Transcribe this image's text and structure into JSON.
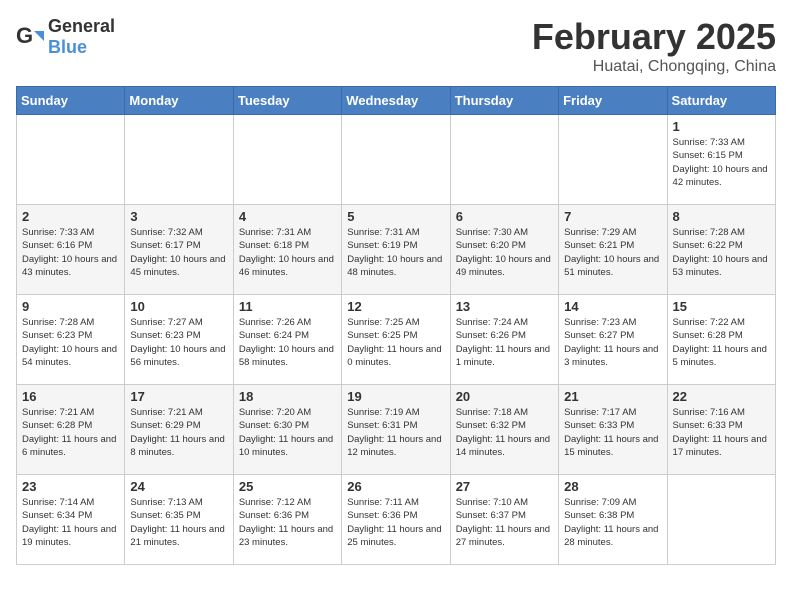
{
  "header": {
    "logo_general": "General",
    "logo_blue": "Blue",
    "month_year": "February 2025",
    "location": "Huatai, Chongqing, China"
  },
  "weekdays": [
    "Sunday",
    "Monday",
    "Tuesday",
    "Wednesday",
    "Thursday",
    "Friday",
    "Saturday"
  ],
  "weeks": [
    [
      {
        "day": "",
        "info": ""
      },
      {
        "day": "",
        "info": ""
      },
      {
        "day": "",
        "info": ""
      },
      {
        "day": "",
        "info": ""
      },
      {
        "day": "",
        "info": ""
      },
      {
        "day": "",
        "info": ""
      },
      {
        "day": "1",
        "info": "Sunrise: 7:33 AM\nSunset: 6:15 PM\nDaylight: 10 hours and 42 minutes."
      }
    ],
    [
      {
        "day": "2",
        "info": "Sunrise: 7:33 AM\nSunset: 6:16 PM\nDaylight: 10 hours and 43 minutes."
      },
      {
        "day": "3",
        "info": "Sunrise: 7:32 AM\nSunset: 6:17 PM\nDaylight: 10 hours and 45 minutes."
      },
      {
        "day": "4",
        "info": "Sunrise: 7:31 AM\nSunset: 6:18 PM\nDaylight: 10 hours and 46 minutes."
      },
      {
        "day": "5",
        "info": "Sunrise: 7:31 AM\nSunset: 6:19 PM\nDaylight: 10 hours and 48 minutes."
      },
      {
        "day": "6",
        "info": "Sunrise: 7:30 AM\nSunset: 6:20 PM\nDaylight: 10 hours and 49 minutes."
      },
      {
        "day": "7",
        "info": "Sunrise: 7:29 AM\nSunset: 6:21 PM\nDaylight: 10 hours and 51 minutes."
      },
      {
        "day": "8",
        "info": "Sunrise: 7:28 AM\nSunset: 6:22 PM\nDaylight: 10 hours and 53 minutes."
      }
    ],
    [
      {
        "day": "9",
        "info": "Sunrise: 7:28 AM\nSunset: 6:23 PM\nDaylight: 10 hours and 54 minutes."
      },
      {
        "day": "10",
        "info": "Sunrise: 7:27 AM\nSunset: 6:23 PM\nDaylight: 10 hours and 56 minutes."
      },
      {
        "day": "11",
        "info": "Sunrise: 7:26 AM\nSunset: 6:24 PM\nDaylight: 10 hours and 58 minutes."
      },
      {
        "day": "12",
        "info": "Sunrise: 7:25 AM\nSunset: 6:25 PM\nDaylight: 11 hours and 0 minutes."
      },
      {
        "day": "13",
        "info": "Sunrise: 7:24 AM\nSunset: 6:26 PM\nDaylight: 11 hours and 1 minute."
      },
      {
        "day": "14",
        "info": "Sunrise: 7:23 AM\nSunset: 6:27 PM\nDaylight: 11 hours and 3 minutes."
      },
      {
        "day": "15",
        "info": "Sunrise: 7:22 AM\nSunset: 6:28 PM\nDaylight: 11 hours and 5 minutes."
      }
    ],
    [
      {
        "day": "16",
        "info": "Sunrise: 7:21 AM\nSunset: 6:28 PM\nDaylight: 11 hours and 6 minutes."
      },
      {
        "day": "17",
        "info": "Sunrise: 7:21 AM\nSunset: 6:29 PM\nDaylight: 11 hours and 8 minutes."
      },
      {
        "day": "18",
        "info": "Sunrise: 7:20 AM\nSunset: 6:30 PM\nDaylight: 11 hours and 10 minutes."
      },
      {
        "day": "19",
        "info": "Sunrise: 7:19 AM\nSunset: 6:31 PM\nDaylight: 11 hours and 12 minutes."
      },
      {
        "day": "20",
        "info": "Sunrise: 7:18 AM\nSunset: 6:32 PM\nDaylight: 11 hours and 14 minutes."
      },
      {
        "day": "21",
        "info": "Sunrise: 7:17 AM\nSunset: 6:33 PM\nDaylight: 11 hours and 15 minutes."
      },
      {
        "day": "22",
        "info": "Sunrise: 7:16 AM\nSunset: 6:33 PM\nDaylight: 11 hours and 17 minutes."
      }
    ],
    [
      {
        "day": "23",
        "info": "Sunrise: 7:14 AM\nSunset: 6:34 PM\nDaylight: 11 hours and 19 minutes."
      },
      {
        "day": "24",
        "info": "Sunrise: 7:13 AM\nSunset: 6:35 PM\nDaylight: 11 hours and 21 minutes."
      },
      {
        "day": "25",
        "info": "Sunrise: 7:12 AM\nSunset: 6:36 PM\nDaylight: 11 hours and 23 minutes."
      },
      {
        "day": "26",
        "info": "Sunrise: 7:11 AM\nSunset: 6:36 PM\nDaylight: 11 hours and 25 minutes."
      },
      {
        "day": "27",
        "info": "Sunrise: 7:10 AM\nSunset: 6:37 PM\nDaylight: 11 hours and 27 minutes."
      },
      {
        "day": "28",
        "info": "Sunrise: 7:09 AM\nSunset: 6:38 PM\nDaylight: 11 hours and 28 minutes."
      },
      {
        "day": "",
        "info": ""
      }
    ]
  ]
}
